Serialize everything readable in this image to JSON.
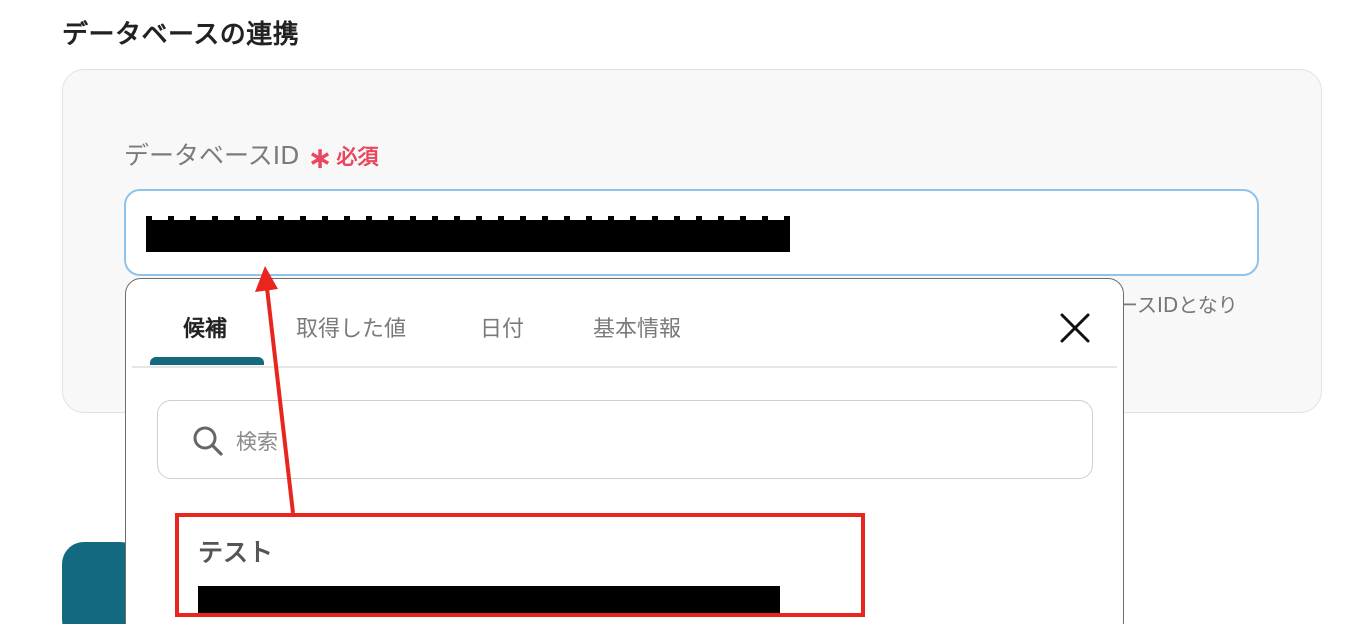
{
  "section": {
    "title": "データベースの連携"
  },
  "field": {
    "label": "データベースID",
    "required_star": "∗",
    "required_text": "必須",
    "hint": "ースIDとなり"
  },
  "popup": {
    "tabs": [
      {
        "label": "候補",
        "active": true
      },
      {
        "label": "取得した値",
        "active": false
      },
      {
        "label": "日付",
        "active": false
      },
      {
        "label": "基本情報",
        "active": false
      }
    ],
    "close_icon": "close-icon",
    "search": {
      "placeholder": "検索",
      "icon": "search-icon"
    },
    "candidates": [
      {
        "label": "テスト",
        "value_redacted": true
      }
    ]
  },
  "colors": {
    "accent": "#136a80",
    "required": "#e8475e",
    "input_focus_border": "#8fc3ea",
    "annotation": "#e8261f"
  }
}
